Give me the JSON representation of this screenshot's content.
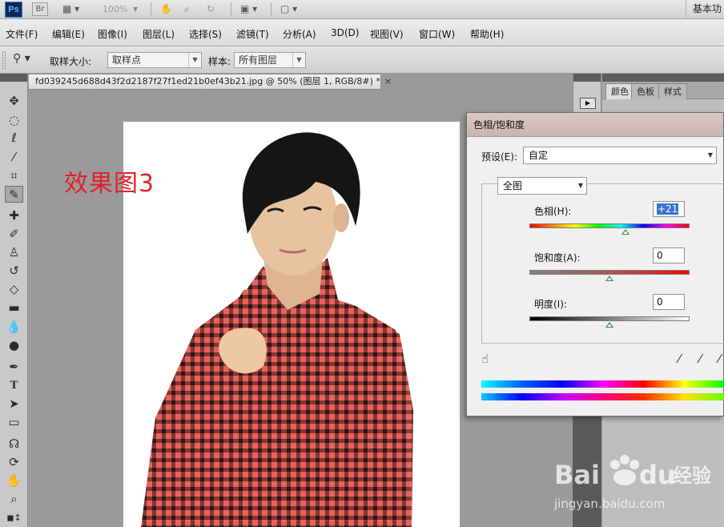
{
  "app": {
    "logo": "Ps",
    "zoom": "100%",
    "workspace": "基本功"
  },
  "menu": [
    "文件(F)",
    "编辑(E)",
    "图像(I)",
    "图层(L)",
    "选择(S)",
    "滤镜(T)",
    "分析(A)",
    "3D(D)",
    "视图(V)",
    "窗口(W)",
    "帮助(H)"
  ],
  "options": {
    "sample_size_label": "取样大小:",
    "sample_size_value": "取样点",
    "sample_label": "样本:",
    "sample_value": "所有图层"
  },
  "document": {
    "tab_title": "fd039245d688d43f2d2187f27f1ed21b0ef43b21.jpg @ 50% (图层 1, RGB/8#) *",
    "close": "×",
    "caption": "效果图3"
  },
  "right_panel": {
    "tabs": [
      "颜色",
      "色板",
      "样式"
    ]
  },
  "dialog": {
    "title": "色相/饱和度",
    "preset_label": "预设(E):",
    "preset_value": "自定",
    "channel_value": "全图",
    "hue_label": "色相(H):",
    "hue_value": "+21",
    "hue_level": 0.6,
    "saturation_label": "饱和度(A):",
    "saturation_value": "0",
    "saturation_level": 0.5,
    "lightness_label": "明度(I):",
    "lightness_value": "0",
    "lightness_level": 0.5
  },
  "colors": {
    "accent_caption": "#e0212a",
    "shirt_red": "#e2574f",
    "thumb_green": "#2e8b3a"
  },
  "icons": {
    "tools": [
      "move-tool-icon",
      "marquee-tool-icon",
      "lasso-tool-icon",
      "quick-select-tool-icon",
      "crop-tool-icon",
      "eyedropper-tool-icon",
      "healing-brush-tool-icon",
      "brush-tool-icon",
      "clone-stamp-tool-icon",
      "history-brush-tool-icon",
      "eraser-tool-icon",
      "gradient-tool-icon",
      "blur-tool-icon",
      "dodge-tool-icon",
      "pen-tool-icon",
      "type-tool-icon",
      "path-select-tool-icon",
      "shape-tool-icon",
      "3d-rotate-tool-icon",
      "3d-orbit-tool-icon",
      "hand-tool-icon",
      "zoom-tool-icon"
    ]
  }
}
